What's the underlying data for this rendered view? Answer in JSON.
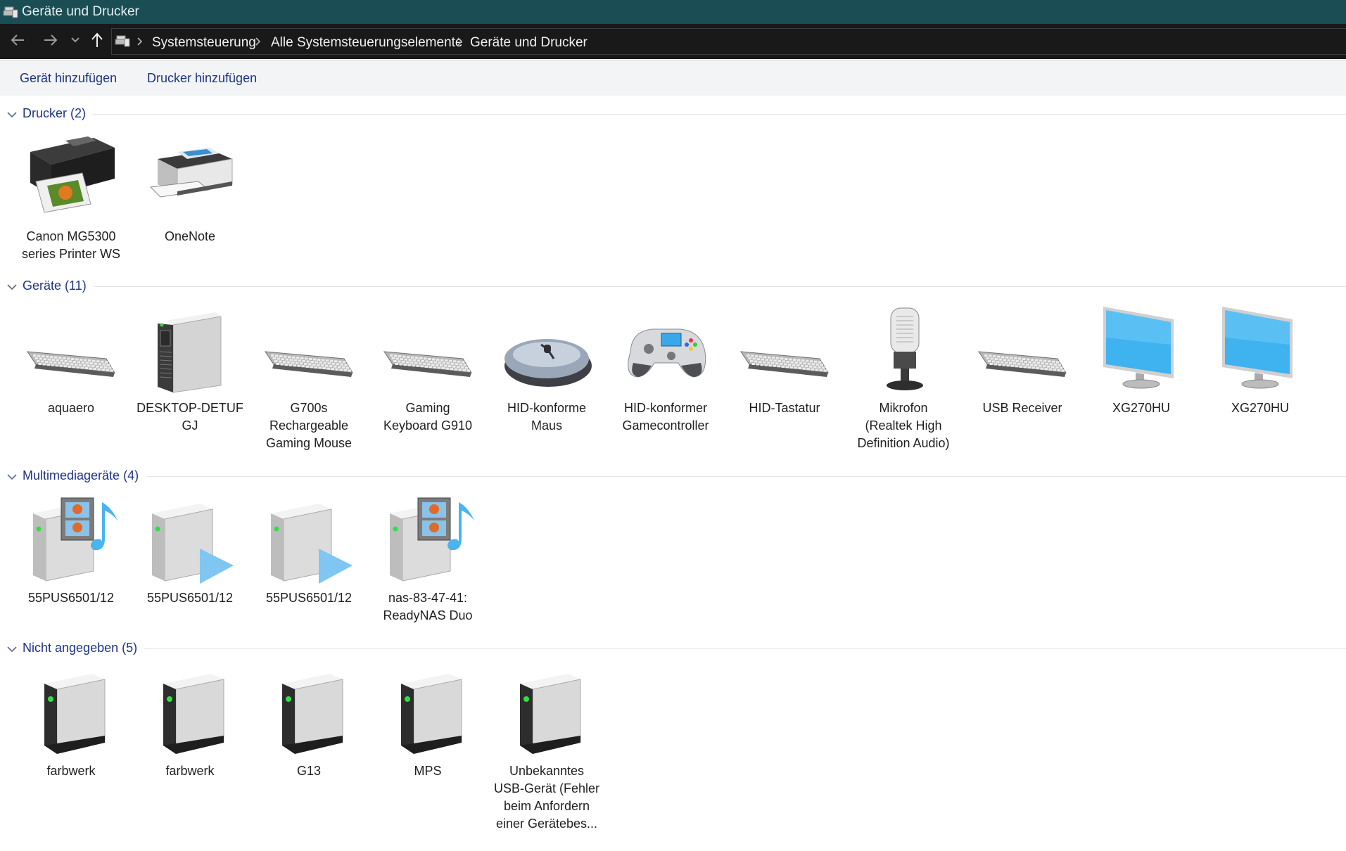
{
  "window": {
    "title": "Geräte und Drucker"
  },
  "nav": {
    "breadcrumbs": [
      "Systemsteuerung",
      "Alle Systemsteuerungselemente",
      "Geräte und Drucker"
    ]
  },
  "commands": {
    "add_device": "Gerät hinzufügen",
    "add_printer": "Drucker hinzufügen"
  },
  "groups": [
    {
      "title": "Drucker",
      "count": "(2)",
      "items": [
        {
          "label": [
            "Canon MG5300",
            "series Printer WS"
          ],
          "icon": "inkjet-printer-icon"
        },
        {
          "label": [
            "OneNote"
          ],
          "icon": "printer-icon"
        }
      ]
    },
    {
      "title": "Geräte",
      "count": "(11)",
      "items": [
        {
          "label": [
            "aquaero"
          ],
          "icon": "keyboard-icon"
        },
        {
          "label": [
            "DESKTOP-DETUF",
            "GJ"
          ],
          "icon": "desktop-tower-icon"
        },
        {
          "label": [
            "G700s",
            "Rechargeable",
            "Gaming Mouse"
          ],
          "icon": "keyboard-icon"
        },
        {
          "label": [
            "Gaming",
            "Keyboard G910"
          ],
          "icon": "keyboard-icon"
        },
        {
          "label": [
            "HID-konforme",
            "Maus"
          ],
          "icon": "mouse-icon"
        },
        {
          "label": [
            "HID-konformer",
            "Gamecontroller"
          ],
          "icon": "gamepad-icon"
        },
        {
          "label": [
            "HID-Tastatur"
          ],
          "icon": "keyboard-icon"
        },
        {
          "label": [
            "Mikrofon",
            "(Realtek High",
            "Definition Audio)"
          ],
          "icon": "microphone-icon"
        },
        {
          "label": [
            "USB Receiver"
          ],
          "icon": "keyboard-icon"
        },
        {
          "label": [
            "XG270HU"
          ],
          "icon": "monitor-icon"
        },
        {
          "label": [
            "XG270HU"
          ],
          "icon": "monitor-icon"
        }
      ]
    },
    {
      "title": "Multimediageräte",
      "count": "(4)",
      "items": [
        {
          "label": [
            "55PUS6501/12"
          ],
          "icon": "media-server-icon"
        },
        {
          "label": [
            "55PUS6501/12"
          ],
          "icon": "media-renderer-icon"
        },
        {
          "label": [
            "55PUS6501/12"
          ],
          "icon": "media-renderer-icon"
        },
        {
          "label": [
            "nas-83-47-41:",
            "ReadyNAS Duo"
          ],
          "icon": "media-server-icon"
        }
      ]
    },
    {
      "title": "Nicht angegeben",
      "count": "(5)",
      "items": [
        {
          "label": [
            "farbwerk"
          ],
          "icon": "generic-device-icon"
        },
        {
          "label": [
            "farbwerk"
          ],
          "icon": "generic-device-icon"
        },
        {
          "label": [
            "G13"
          ],
          "icon": "generic-device-icon"
        },
        {
          "label": [
            "MPS"
          ],
          "icon": "generic-device-icon"
        },
        {
          "label": [
            "Unbekanntes",
            "USB-Gerät (Fehler",
            "beim Anfordern",
            "einer Gerätebes..."
          ],
          "icon": "generic-device-icon"
        }
      ]
    }
  ],
  "colors": {
    "titlebar": "#1b4d55",
    "navbar": "#191919",
    "link": "#1e3287",
    "commandbar": "#f3f4f6"
  }
}
